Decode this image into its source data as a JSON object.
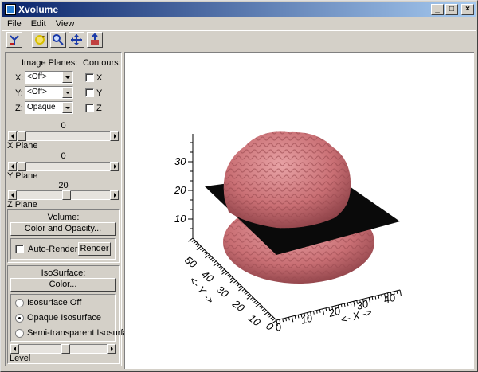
{
  "window": {
    "title": "Xvolume"
  },
  "menu": [
    "File",
    "Edit",
    "View"
  ],
  "toolbar": {
    "tools": [
      "reset-icon",
      "rotate-icon",
      "zoom-icon",
      "pan-icon",
      "select-icon"
    ]
  },
  "planes": {
    "image_planes_label": "Image Planes:",
    "contours_label": "Contours:",
    "rows": [
      {
        "axis": "X:",
        "value": "<Off>",
        "contour": "X"
      },
      {
        "axis": "Y:",
        "value": "<Off>",
        "contour": "Y"
      },
      {
        "axis": "Z:",
        "value": "Opaque",
        "contour": "Z"
      }
    ],
    "x_plane": {
      "value": "0",
      "label": "X Plane"
    },
    "y_plane": {
      "value": "0",
      "label": "Y Plane"
    },
    "z_plane": {
      "value": "20",
      "label": "Z Plane"
    }
  },
  "volume": {
    "title": "Volume:",
    "color_button": "Color and Opacity...",
    "auto_render": "Auto-Render",
    "render_button": "Render"
  },
  "isosurface": {
    "title": "IsoSurface:",
    "color_button": "Color...",
    "options": [
      "Isosurface Off",
      "Opaque Isosurface",
      "Semi-transparent Isosurface"
    ],
    "selected": "Opaque Isosurface",
    "level_label": "Level"
  },
  "plot": {
    "z_ticks": [
      "30",
      "20",
      "10"
    ],
    "y_ticks": [
      "50",
      "40",
      "30",
      "20",
      "10",
      "0"
    ],
    "x_ticks": [
      "0",
      "10",
      "20",
      "30",
      "40"
    ],
    "y_axis_title": "<- Y ->",
    "x_axis_title": "<- X ->",
    "colors": {
      "brain": "#c96f74",
      "plane": "#0a0a0a"
    }
  }
}
